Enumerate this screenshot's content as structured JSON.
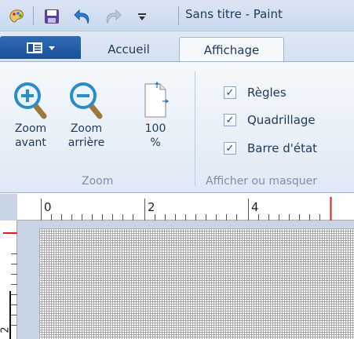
{
  "window": {
    "title": "Sans titre - Paint"
  },
  "tabs": {
    "home": "Accueil",
    "view": "Affichage"
  },
  "ribbon": {
    "zoom_group": {
      "label": "Zoom",
      "zoom_in": {
        "line1": "Zoom",
        "line2": "avant"
      },
      "zoom_out": {
        "line1": "Zoom",
        "line2": "arrière"
      },
      "zoom_100": {
        "line1": "100",
        "line2": "%"
      }
    },
    "show_hide_group": {
      "label": "Afficher ou masquer",
      "rulers": {
        "label": "Règles",
        "checked": true
      },
      "gridlines": {
        "label": "Quadrillage",
        "checked": true
      },
      "status_bar": {
        "label": "Barre d'état",
        "checked": true
      }
    }
  },
  "ruler": {
    "labels": [
      "0",
      "2",
      "4"
    ],
    "side_label": "2"
  },
  "colors": {
    "accent": "#1b4f96",
    "ruler_marker": "#d62020"
  },
  "icons": [
    "paint-app-icon",
    "save-icon",
    "undo-icon",
    "redo-icon",
    "customize-arrow-icon",
    "menu-icon",
    "zoom-in-icon",
    "zoom-out-icon",
    "page-100-icon",
    "checkbox-icon"
  ]
}
